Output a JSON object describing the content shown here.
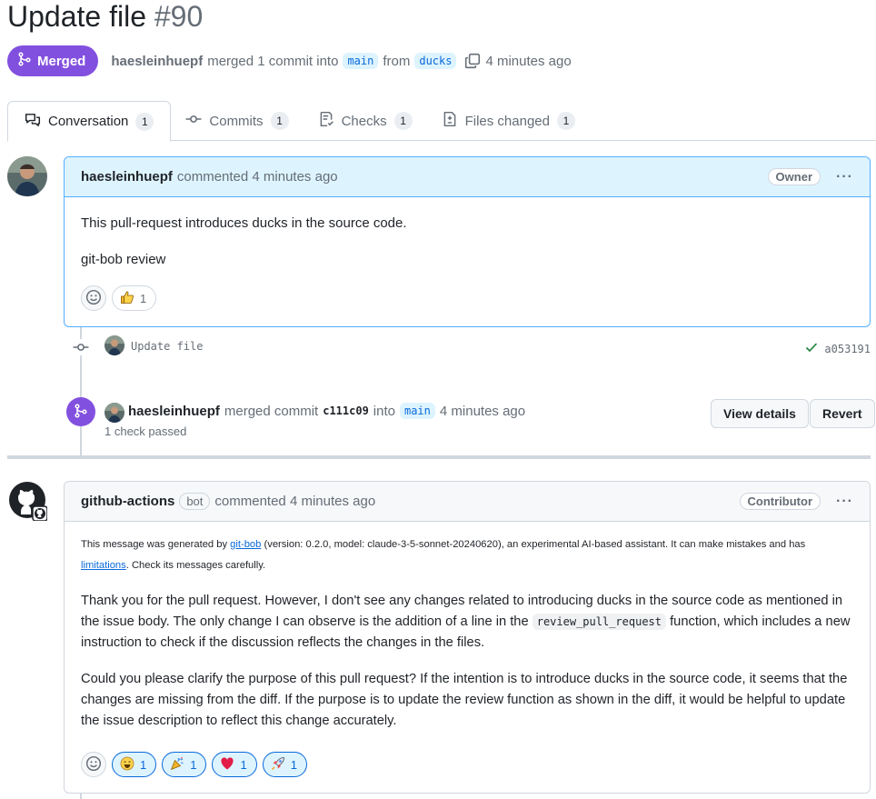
{
  "pr": {
    "title": "Update file",
    "number": "#90",
    "state_label": "Merged",
    "author": "haesleinhuepf",
    "merged_text": "merged 1 commit into",
    "base_branch": "main",
    "from_text": "from",
    "head_branch": "ducks",
    "time_ago": "4 minutes ago"
  },
  "tabs": [
    {
      "label": "Conversation",
      "count": "1"
    },
    {
      "label": "Commits",
      "count": "1"
    },
    {
      "label": "Checks",
      "count": "1"
    },
    {
      "label": "Files changed",
      "count": "1"
    }
  ],
  "comment1": {
    "author": "haesleinhuepf",
    "action": "commented 4 minutes ago",
    "role": "Owner",
    "body": [
      "This pull-request introduces ducks in the source code.",
      "git-bob review"
    ],
    "reactions": [
      {
        "emoji": "thumbs-up",
        "count": "1"
      }
    ]
  },
  "commit_event": {
    "message": "Update file",
    "status_icon": "check-icon",
    "sha": "a053191"
  },
  "merge_event": {
    "author": "haesleinhuepf",
    "action": "merged commit",
    "sha": "c111c09",
    "into": "into",
    "branch": "main",
    "time_ago": "4 minutes ago",
    "checks": "1 check passed",
    "view_details": "View details",
    "revert": "Revert"
  },
  "comment2": {
    "author": "github-actions",
    "bot_label": "bot",
    "action": "commented 4 minutes ago",
    "role": "Contributor",
    "note_pre": "This message was generated by ",
    "note_link1": "git-bob",
    "note_mid": " (version: 0.2.0, model: claude-3-5-sonnet-20240620), an experimental AI-based assistant. It can make mistakes and has ",
    "note_link2": "limitations",
    "note_post": ". Check its messages carefully.",
    "para1_pre": "Thank you for the pull request. However, I don't see any changes related to introducing ducks in the source code as mentioned in the issue body. The only change I can observe is the addition of a line in the ",
    "para1_code": "review_pull_request",
    "para1_post": " function, which includes a new instruction to check if the discussion reflects the changes in the files.",
    "para2": "Could you please clarify the purpose of this pull request? If the intention is to introduce ducks in the source code, it seems that the changes are missing from the diff. If the purpose is to update the review function as shown in the diff, it would be helpful to update the issue description to reflect this change accurately.",
    "reactions": [
      {
        "emoji": "smile",
        "count": "1"
      },
      {
        "emoji": "tada",
        "count": "1"
      },
      {
        "emoji": "heart",
        "count": "1"
      },
      {
        "emoji": "rocket",
        "count": "1"
      }
    ]
  },
  "colors": {
    "merged": "#8250df",
    "link": "#0969da",
    "header_bg_owner": "#ddf4ff",
    "header_bg_bot": "#f6f8fa",
    "check": "#1a7f37"
  }
}
